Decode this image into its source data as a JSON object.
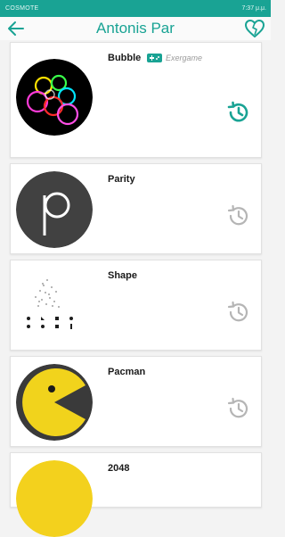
{
  "status_bar": {
    "carrier": "COSMOTE",
    "right_text": "7:37 μ.μ."
  },
  "header": {
    "title": "Antonis Par",
    "back_icon": "arrow-left-icon",
    "favorite_icon": "heart-icon"
  },
  "colors": {
    "accent": "#19a394",
    "history_inactive": "#b5b5b5"
  },
  "games": [
    {
      "title": "Bubble",
      "tag": "Exergame",
      "tag_icon": "gamepad-icon",
      "history_icon": "history-icon",
      "history_active": true
    },
    {
      "title": "Parity",
      "history_icon": "history-icon",
      "history_active": false
    },
    {
      "title": "Shape",
      "history_icon": "history-icon",
      "history_active": false
    },
    {
      "title": "Pacman",
      "history_icon": "history-icon",
      "history_active": false
    },
    {
      "title": "2048"
    }
  ]
}
